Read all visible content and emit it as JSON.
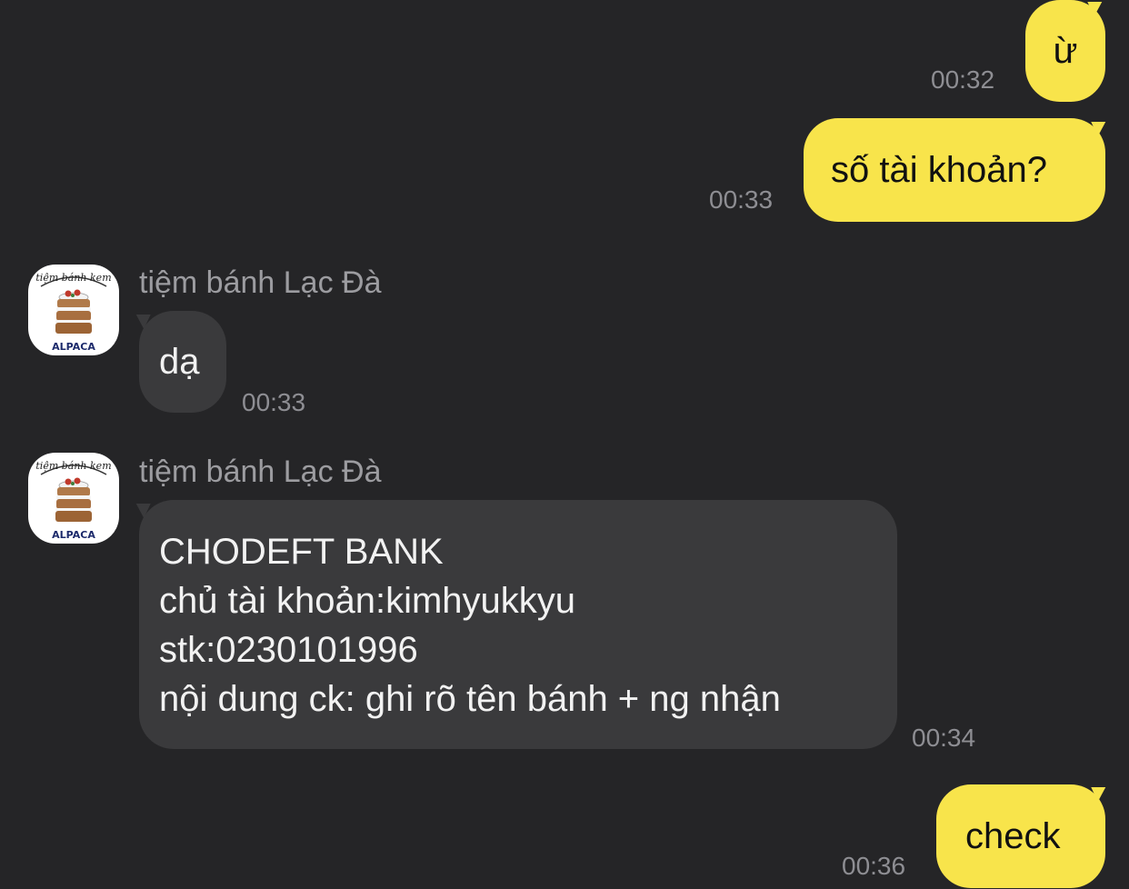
{
  "chat": {
    "contact_name": "tiệm bánh Lạc Đà",
    "avatar": {
      "icon": "cake-shop-logo",
      "top_text": "tiệm bánh kem",
      "bottom_text": "ALPACA"
    },
    "colors": {
      "background": "#252527",
      "my_bubble": "#f8e44b",
      "their_bubble": "#3a3a3c",
      "timestamp": "#8e8e93"
    },
    "messages": [
      {
        "from": "me",
        "text": "ừ",
        "time": "00:32"
      },
      {
        "from": "me",
        "text": "số tài khoản?",
        "time": "00:33"
      },
      {
        "from": "them",
        "sender": "tiệm bánh Lạc Đà",
        "text": "dạ",
        "time": "00:33"
      },
      {
        "from": "them",
        "sender": "tiệm bánh Lạc Đà",
        "lines": [
          "CHODEFT BANK",
          "chủ tài khoản:kimhyukkyu",
          "stk:0230101996",
          "nội dung ck: ghi rõ tên bánh + ng nhận"
        ],
        "time": "00:34"
      },
      {
        "from": "me",
        "text": "check",
        "time": "00:36"
      }
    ]
  }
}
